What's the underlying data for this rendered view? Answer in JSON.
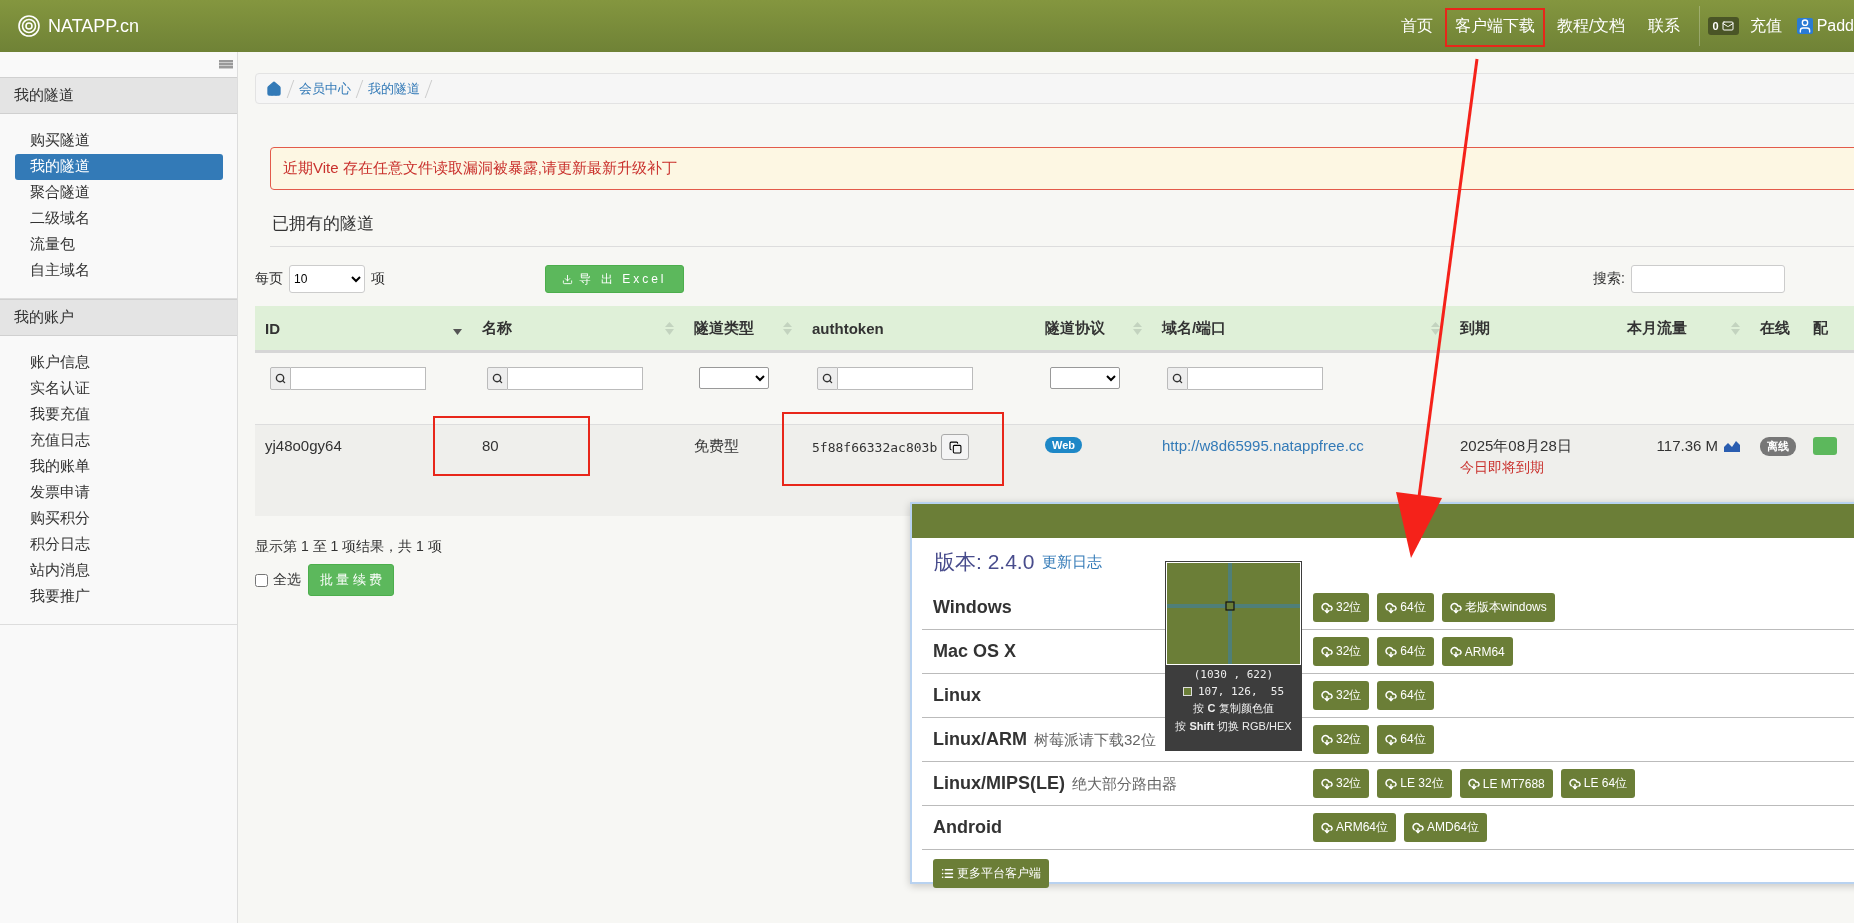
{
  "header": {
    "logo": "NATAPP.cn",
    "nav": [
      {
        "label": "首页",
        "highlighted": false
      },
      {
        "label": "客户端下载",
        "highlighted": true
      },
      {
        "label": "教程/文档",
        "highlighted": false
      },
      {
        "label": "联系",
        "highlighted": false
      }
    ],
    "message_count": "0",
    "recharge": "充值",
    "user": "Padd"
  },
  "sidebar": {
    "sections": [
      {
        "title": "我的隧道",
        "items": [
          {
            "label": "购买隧道",
            "selected": false
          },
          {
            "label": "我的隧道",
            "selected": true
          },
          {
            "label": "聚合隧道",
            "selected": false
          },
          {
            "label": "二级域名",
            "selected": false
          },
          {
            "label": "流量包",
            "selected": false
          },
          {
            "label": "自主域名",
            "selected": false
          }
        ]
      },
      {
        "title": "我的账户",
        "items": [
          {
            "label": "账户信息",
            "selected": false
          },
          {
            "label": "实名认证",
            "selected": false
          },
          {
            "label": "我要充值",
            "selected": false
          },
          {
            "label": "充值日志",
            "selected": false
          },
          {
            "label": "我的账单",
            "selected": false
          },
          {
            "label": "发票申请",
            "selected": false
          },
          {
            "label": "购买积分",
            "selected": false
          },
          {
            "label": "积分日志",
            "selected": false
          },
          {
            "label": "站内消息",
            "selected": false
          },
          {
            "label": "我要推广",
            "selected": false
          }
        ]
      }
    ]
  },
  "breadcrumb": [
    "会员中心",
    "我的隧道"
  ],
  "alert": "近期Vite 存在任意文件读取漏洞被暴露,请更新最新升级补丁",
  "heading": "已拥有的隧道",
  "controls": {
    "per_page_label": "每页",
    "per_page": "10",
    "per_page_suffix": "项",
    "export": "导 出 Excel",
    "search_label": "搜索:"
  },
  "table": {
    "columns": [
      {
        "label": "ID",
        "sortable": true,
        "sorted": true
      },
      {
        "label": "名称",
        "sortable": true,
        "sorted": false
      },
      {
        "label": "隧道类型",
        "sortable": true,
        "sorted": false
      },
      {
        "label": "authtoken",
        "sortable": false
      },
      {
        "label": "隧道协议",
        "sortable": true,
        "sorted": false
      },
      {
        "label": "域名/端口",
        "sortable": true,
        "sorted": false
      },
      {
        "label": "到期",
        "sortable": false
      },
      {
        "label": "本月流量",
        "sortable": true,
        "sorted": false
      },
      {
        "label": "在线",
        "sortable": false
      },
      {
        "label": "配",
        "sortable": false
      }
    ],
    "filters": [
      {
        "kind": "text"
      },
      {
        "kind": "text"
      },
      {
        "kind": "select"
      },
      {
        "kind": "text"
      },
      {
        "kind": "select"
      },
      {
        "kind": "text"
      },
      {
        "kind": "none"
      },
      {
        "kind": "none"
      },
      {
        "kind": "none"
      },
      {
        "kind": "none"
      }
    ],
    "rows": [
      {
        "id": "yj48o0gy64",
        "name": {
          "text": "80",
          "highlighted": true
        },
        "type": "免费型",
        "authtoken": {
          "text": "5f88f66332ac803b",
          "highlighted": true
        },
        "protocol": "Web",
        "domain": "http://w8d65995.natappfree.cc",
        "expiry": "2025年08月28日",
        "expiry_note": "今日即将到期",
        "traffic": "117.36 M",
        "online": "离线",
        "column_10": {
          "kind": "tag"
        }
      }
    ]
  },
  "summary": "显示第 1 至 1 项结果，共 1 项",
  "select_all": {
    "label": "全选",
    "checked": false
  },
  "renew_button": "批 量 续 费",
  "download_panel": {
    "version": "版本: 2.4.0",
    "changelog": "更新日志",
    "platforms": [
      {
        "name": "Windows",
        "buttons": [
          "32位",
          "64位",
          "老版本windows"
        ]
      },
      {
        "name": "Mac OS X",
        "buttons": [
          "32位",
          "64位",
          "ARM64"
        ]
      },
      {
        "name": "Linux",
        "buttons": [
          "32位",
          "64位"
        ]
      },
      {
        "name": "Linux/ARM",
        "note": "树莓派请下载32位",
        "buttons": [
          "32位",
          "64位"
        ]
      },
      {
        "name": "Linux/MIPS(LE)",
        "note": "绝大部分路由器",
        "buttons": [
          "32位",
          "LE 32位",
          "LE MT7688",
          "LE 64位"
        ]
      },
      {
        "name": "Android",
        "buttons": [
          "ARM64位",
          "AMD64位"
        ]
      }
    ],
    "more": "更多平台客户端"
  },
  "color_picker": {
    "color": "#6b7e37",
    "coords": "(1030 , 622)",
    "rgb": "107, 126,  55",
    "hints": [
      "按 **C** 复制颜色值",
      "按 **Shift** 切换 RGB/HEX"
    ]
  },
  "annotation_arrow": true
}
